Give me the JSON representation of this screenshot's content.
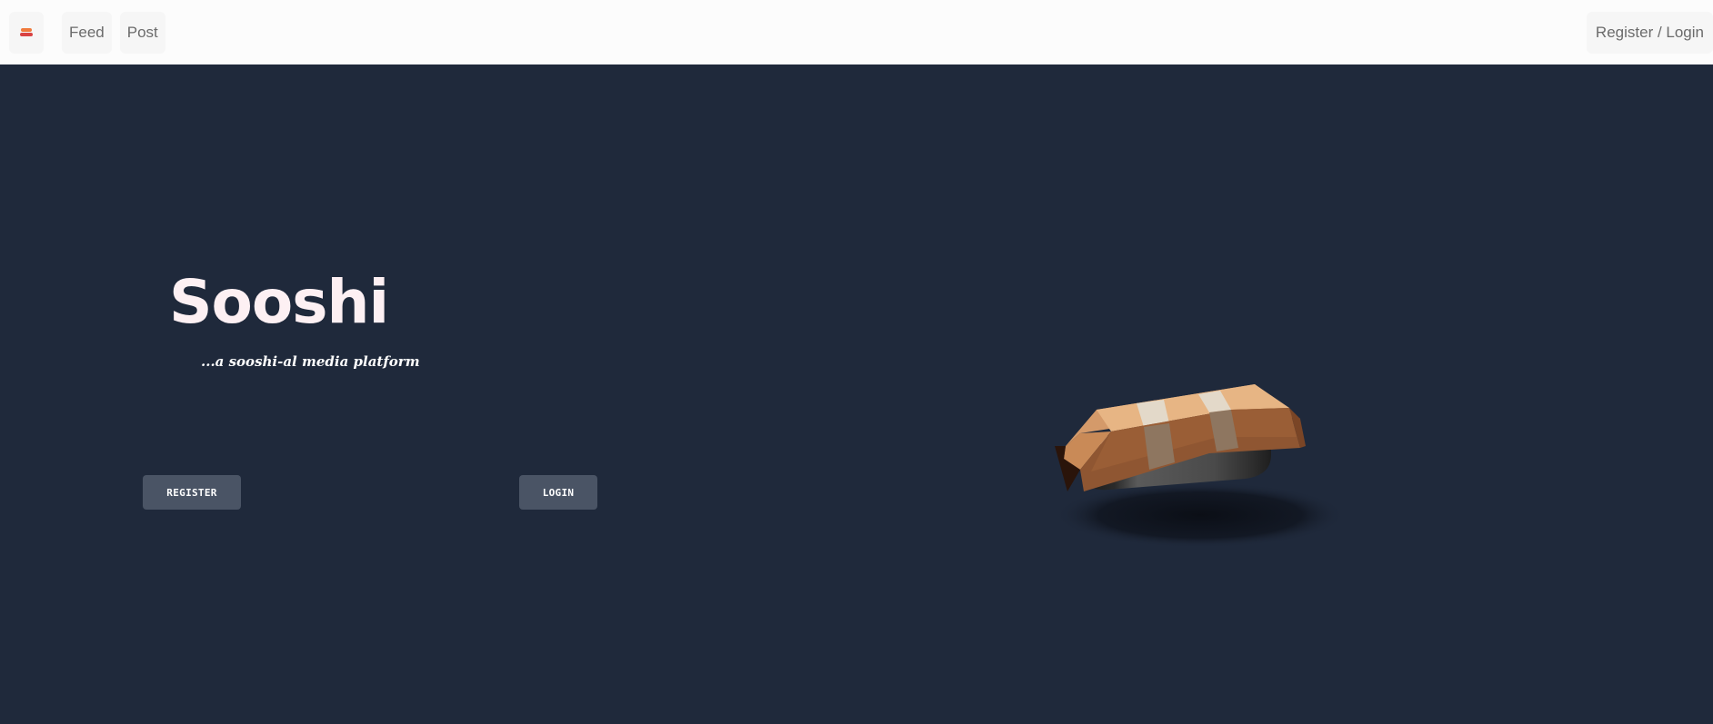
{
  "navbar": {
    "logo_icon": "sushi-logo-icon",
    "links": [
      {
        "label": "Feed"
      },
      {
        "label": "Post"
      }
    ],
    "auth_label": "Register / Login"
  },
  "hero": {
    "title": "Sooshi",
    "tagline": "...a sooshi-al media platform",
    "register_label": "REGISTER",
    "login_label": "LOGIN",
    "illustration_icon": "sushi-nigiri-illustration"
  },
  "colors": {
    "background": "#1f293b",
    "navbar_background": "#fcfcfc",
    "button_background": "#4a5465",
    "title_color": "#fdf0f3"
  }
}
